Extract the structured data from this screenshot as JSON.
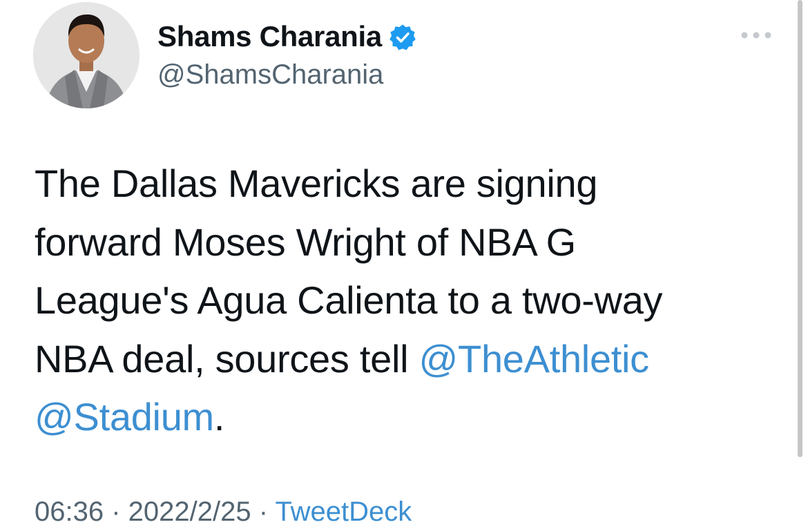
{
  "author": {
    "display_name": "Shams Charania",
    "handle": "@ShamsCharania",
    "verified": true,
    "avatar_icon": "profile-photo"
  },
  "tweet": {
    "text_parts": [
      "The Dallas Mavericks are signing",
      "forward Moses Wright of NBA G",
      "League's Agua Calienta to a two-way",
      "NBA deal, sources tell "
    ],
    "mention_1": "@TheAthletic",
    "mention_2": "@Stadium",
    "end_punct": "."
  },
  "meta": {
    "time": "06:36",
    "separator": " · ",
    "date": "2022/2/25",
    "source": "TweetDeck"
  },
  "icons": {
    "more": "more-horizontal-icon",
    "verified": "verified-badge-icon"
  },
  "colors": {
    "text": "#0f1419",
    "secondary": "#536471",
    "link": "#3d8fd1",
    "verified": "#1d9bf0"
  }
}
